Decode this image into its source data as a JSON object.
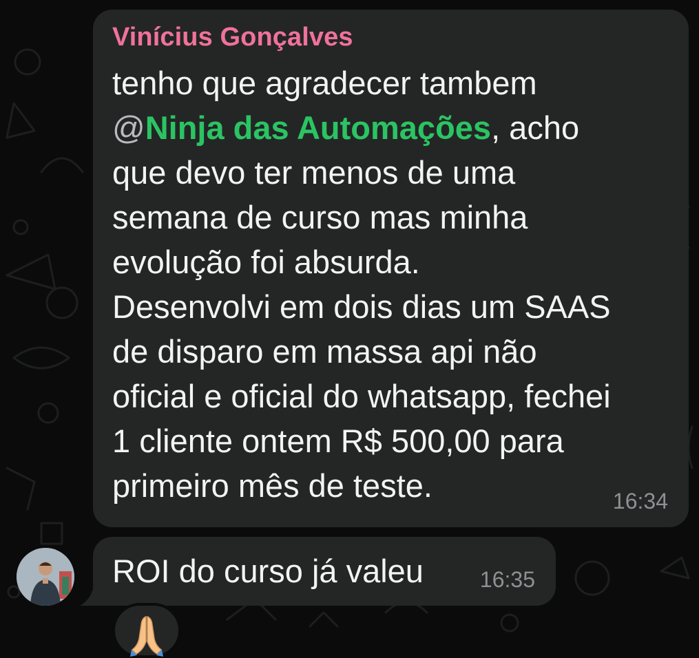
{
  "message_1": {
    "sender": "Vinícius Gonçalves",
    "lines": {
      "l1": "tenho que agradecer tambem",
      "l2_at": "@",
      "l2_mention": "Ninja das Automações",
      "l2_rest": ", acho",
      "l3": "que devo ter menos de uma",
      "l4": "semana de curso mas minha",
      "l5": "evolução foi absurda.",
      "l6": "Desenvolvi em dois dias um SAAS",
      "l7": "de disparo em massa api não",
      "l8": "oficial e oficial do whatsapp, fechei",
      "l9": "1 cliente ontem R$ 500,00 para",
      "l10": "primeiro mês de teste."
    },
    "time": "16:34"
  },
  "message_2": {
    "text": "ROI do curso já valeu",
    "time": "16:35",
    "reaction": "folded-hands-emoji"
  },
  "avatar": {
    "icon": "person-photo-avatar"
  },
  "colors": {
    "background": "#0b0b0b",
    "bubble": "#242626",
    "sender_name": "#f0729b",
    "mention": "#2bc463",
    "text": "#f2f3f3",
    "timestamp": "#8c9192"
  }
}
